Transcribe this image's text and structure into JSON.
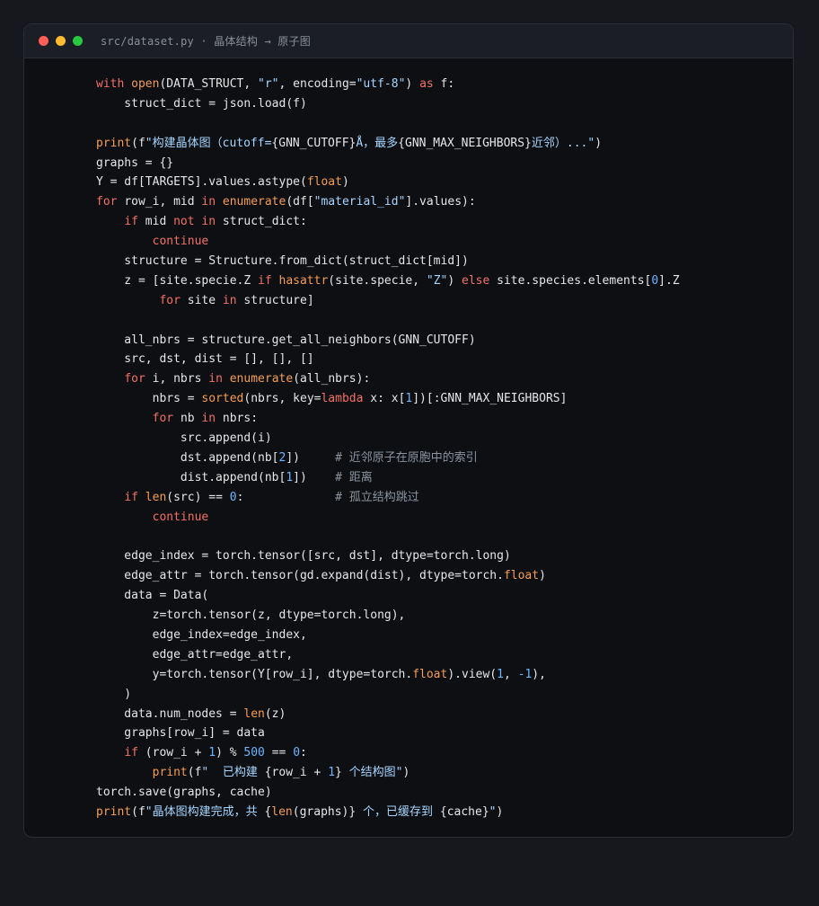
{
  "window": {
    "title": "src/dataset.py · 晶体结构 → 原子图"
  },
  "colors": {
    "keyword": "#f47067",
    "function": "#f69d50",
    "string": "#a5d6ff",
    "number": "#6cb6ff",
    "comment": "#8b949e",
    "plain": "#e6e6e6"
  },
  "code_lines": [
    [
      [
        "kw",
        "with "
      ],
      [
        "fn",
        "open"
      ],
      [
        "pl",
        "(DATA_STRUCT, "
      ],
      [
        "str",
        "\"r\""
      ],
      [
        "pl",
        ", encoding="
      ],
      [
        "str",
        "\"utf-8\""
      ],
      [
        "pl",
        ") "
      ],
      [
        "kw",
        "as"
      ],
      [
        "pl",
        " f:"
      ]
    ],
    [
      [
        "pl",
        "    struct_dict = json.load(f)"
      ]
    ],
    [],
    [
      [
        "fn",
        "print"
      ],
      [
        "pl",
        "(f"
      ],
      [
        "str",
        "\"构建晶体图（cutoff="
      ],
      [
        "pl",
        "{GNN_CUTOFF}"
      ],
      [
        "str",
        "Å，最多"
      ],
      [
        "pl",
        "{GNN_MAX_NEIGHBORS}"
      ],
      [
        "str",
        "近邻）...\""
      ],
      [
        "pl",
        ")"
      ]
    ],
    [
      [
        "pl",
        "graphs = {}"
      ]
    ],
    [
      [
        "pl",
        "Y = df[TARGETS].values.astype("
      ],
      [
        "fn",
        "float"
      ],
      [
        "pl",
        ")"
      ]
    ],
    [
      [
        "kw",
        "for "
      ],
      [
        "pl",
        "row_i, mid "
      ],
      [
        "kw",
        "in "
      ],
      [
        "fn",
        "enumerate"
      ],
      [
        "pl",
        "(df["
      ],
      [
        "str",
        "\"material_id\""
      ],
      [
        "pl",
        "].values):"
      ]
    ],
    [
      [
        "pl",
        "    "
      ],
      [
        "kw",
        "if "
      ],
      [
        "pl",
        "mid "
      ],
      [
        "kw",
        "not in "
      ],
      [
        "pl",
        "struct_dict:"
      ]
    ],
    [
      [
        "pl",
        "        "
      ],
      [
        "kw",
        "continue"
      ]
    ],
    [
      [
        "pl",
        "    structure = Structure.from_dict(struct_dict[mid])"
      ]
    ],
    [
      [
        "pl",
        "    z = [site.specie.Z "
      ],
      [
        "kw",
        "if "
      ],
      [
        "fn",
        "hasattr"
      ],
      [
        "pl",
        "(site.specie, "
      ],
      [
        "str",
        "\"Z\""
      ],
      [
        "pl",
        ") "
      ],
      [
        "kw",
        "else "
      ],
      [
        "pl",
        "site.species.elements["
      ],
      [
        "num",
        "0"
      ],
      [
        "pl",
        "].Z"
      ]
    ],
    [
      [
        "pl",
        "         "
      ],
      [
        "kw",
        "for "
      ],
      [
        "pl",
        "site "
      ],
      [
        "kw",
        "in "
      ],
      [
        "pl",
        "structure]"
      ]
    ],
    [],
    [
      [
        "pl",
        "    all_nbrs = structure.get_all_neighbors(GNN_CUTOFF)"
      ]
    ],
    [
      [
        "pl",
        "    src, dst, dist = [], [], []"
      ]
    ],
    [
      [
        "pl",
        "    "
      ],
      [
        "kw",
        "for "
      ],
      [
        "pl",
        "i, nbrs "
      ],
      [
        "kw",
        "in "
      ],
      [
        "fn",
        "enumerate"
      ],
      [
        "pl",
        "(all_nbrs):"
      ]
    ],
    [
      [
        "pl",
        "        nbrs = "
      ],
      [
        "fn",
        "sorted"
      ],
      [
        "pl",
        "(nbrs, key="
      ],
      [
        "kw",
        "lambda "
      ],
      [
        "pl",
        "x: x["
      ],
      [
        "num",
        "1"
      ],
      [
        "pl",
        "])[:GNN_MAX_NEIGHBORS]"
      ]
    ],
    [
      [
        "pl",
        "        "
      ],
      [
        "kw",
        "for "
      ],
      [
        "pl",
        "nb "
      ],
      [
        "kw",
        "in "
      ],
      [
        "pl",
        "nbrs:"
      ]
    ],
    [
      [
        "pl",
        "            src.append(i)"
      ]
    ],
    [
      [
        "pl",
        "            dst.append(nb["
      ],
      [
        "num",
        "2"
      ],
      [
        "pl",
        "])     "
      ],
      [
        "cm",
        "# 近邻原子在原胞中的索引"
      ]
    ],
    [
      [
        "pl",
        "            dist.append(nb["
      ],
      [
        "num",
        "1"
      ],
      [
        "pl",
        "])    "
      ],
      [
        "cm",
        "# 距离"
      ]
    ],
    [
      [
        "pl",
        "    "
      ],
      [
        "kw",
        "if "
      ],
      [
        "fn",
        "len"
      ],
      [
        "pl",
        "(src) == "
      ],
      [
        "num",
        "0"
      ],
      [
        "pl",
        ":             "
      ],
      [
        "cm",
        "# 孤立结构跳过"
      ]
    ],
    [
      [
        "pl",
        "        "
      ],
      [
        "kw",
        "continue"
      ]
    ],
    [],
    [
      [
        "pl",
        "    edge_index = torch.tensor([src, dst], dtype=torch.long)"
      ]
    ],
    [
      [
        "pl",
        "    edge_attr = torch.tensor(gd.expand(dist), dtype=torch."
      ],
      [
        "fn",
        "float"
      ],
      [
        "pl",
        ")"
      ]
    ],
    [
      [
        "pl",
        "    data = Data("
      ]
    ],
    [
      [
        "pl",
        "        z=torch.tensor(z, dtype=torch.long),"
      ]
    ],
    [
      [
        "pl",
        "        edge_index=edge_index,"
      ]
    ],
    [
      [
        "pl",
        "        edge_attr=edge_attr,"
      ]
    ],
    [
      [
        "pl",
        "        y=torch.tensor(Y[row_i], dtype=torch."
      ],
      [
        "fn",
        "float"
      ],
      [
        "pl",
        ").view("
      ],
      [
        "num",
        "1"
      ],
      [
        "pl",
        ", "
      ],
      [
        "num",
        "-1"
      ],
      [
        "pl",
        "),"
      ]
    ],
    [
      [
        "pl",
        "    )"
      ]
    ],
    [
      [
        "pl",
        "    data.num_nodes = "
      ],
      [
        "fn",
        "len"
      ],
      [
        "pl",
        "(z)"
      ]
    ],
    [
      [
        "pl",
        "    graphs[row_i] = data"
      ]
    ],
    [
      [
        "pl",
        "    "
      ],
      [
        "kw",
        "if "
      ],
      [
        "pl",
        "(row_i + "
      ],
      [
        "num",
        "1"
      ],
      [
        "pl",
        ") % "
      ],
      [
        "num",
        "500"
      ],
      [
        "pl",
        " == "
      ],
      [
        "num",
        "0"
      ],
      [
        "pl",
        ":"
      ]
    ],
    [
      [
        "pl",
        "        "
      ],
      [
        "fn",
        "print"
      ],
      [
        "pl",
        "(f"
      ],
      [
        "str",
        "\"  已构建 "
      ],
      [
        "pl",
        "{row_i + "
      ],
      [
        "num",
        "1"
      ],
      [
        "pl",
        "}"
      ],
      [
        "str",
        " 个结构图\""
      ],
      [
        "pl",
        ")"
      ]
    ],
    [
      [
        "pl",
        "torch.save(graphs, cache)"
      ]
    ],
    [
      [
        "fn",
        "print"
      ],
      [
        "pl",
        "(f"
      ],
      [
        "str",
        "\"晶体图构建完成，共 "
      ],
      [
        "pl",
        "{"
      ],
      [
        "fn",
        "len"
      ],
      [
        "pl",
        "(graphs)}"
      ],
      [
        "str",
        " 个，已缓存到 "
      ],
      [
        "pl",
        "{cache}"
      ],
      [
        "str",
        "\""
      ],
      [
        "pl",
        ")"
      ]
    ]
  ]
}
